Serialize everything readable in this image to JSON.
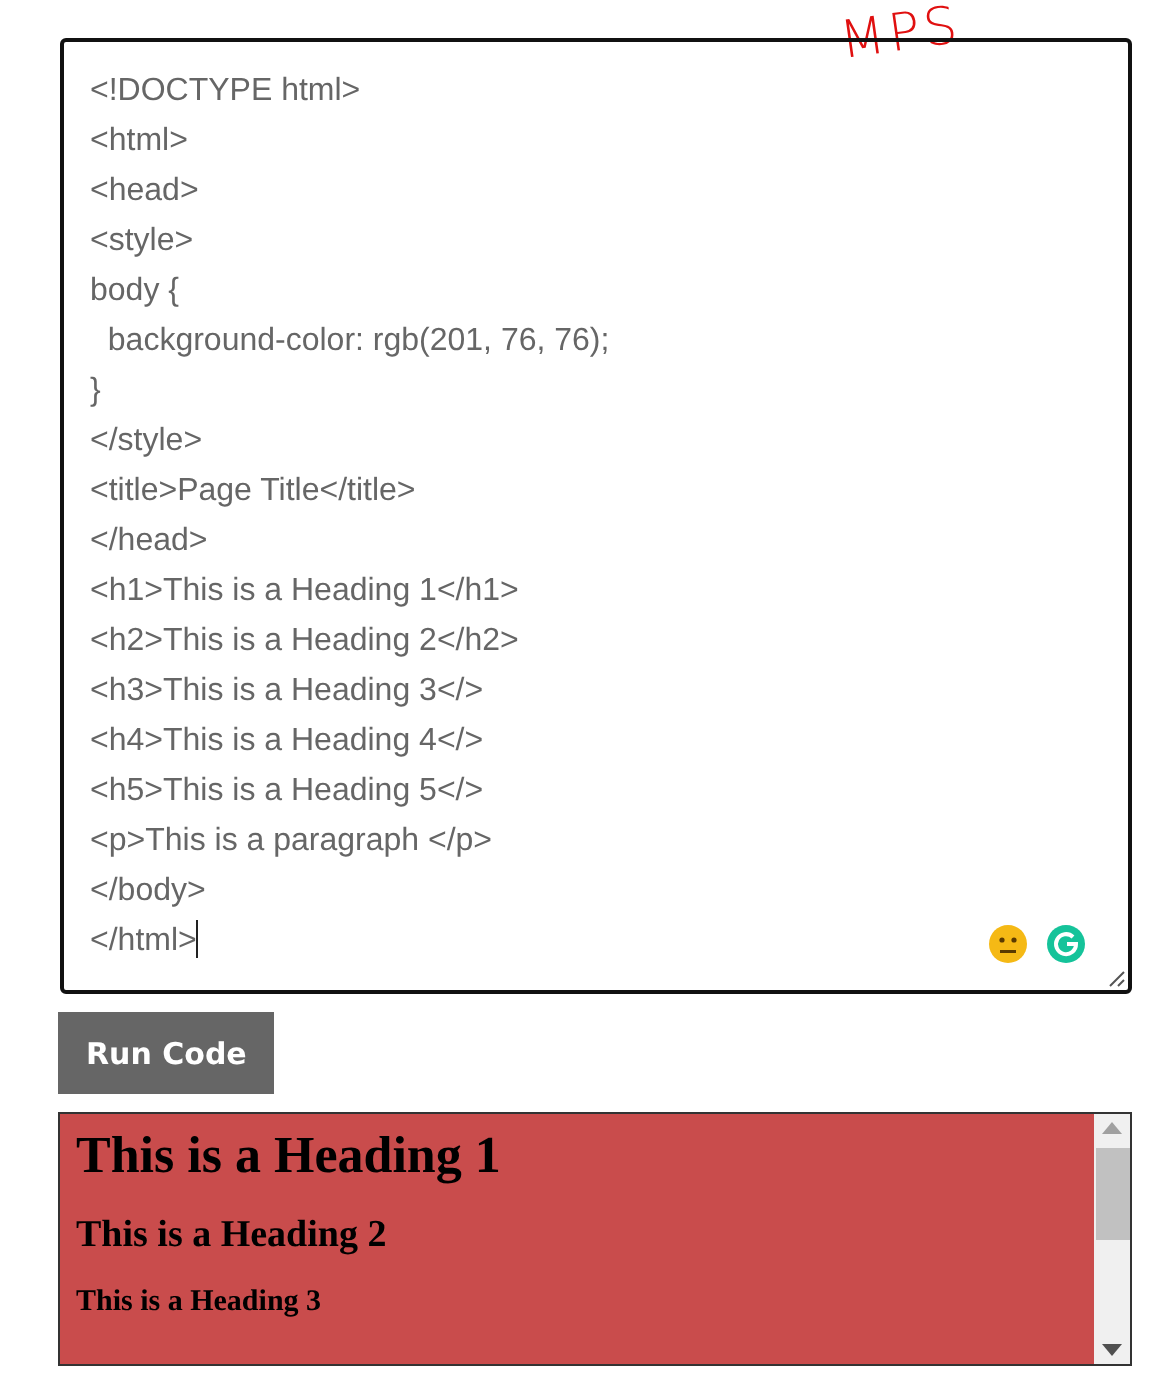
{
  "annotation": "MPS",
  "editor": {
    "lines": [
      "<!DOCTYPE html>",
      "<html>",
      "<head>",
      "<style>",
      "body {",
      "  background-color: rgb(201, 76, 76);",
      "}",
      "</style>",
      "<title>Page Title</title>",
      "</head>",
      "<h1>This is a Heading 1</h1>",
      "<h2>This is a Heading 2</h2>",
      "<h3>This is a Heading 3</>",
      "<h4>This is a Heading 4</>",
      "<h5>This is a Heading 5</>",
      "<p>This is a paragraph </p>",
      "</body>",
      "</html>"
    ]
  },
  "run_button": {
    "label": "Run Code"
  },
  "preview": {
    "headings": [
      {
        "kind": "h1",
        "text": "This is a Heading 1"
      },
      {
        "kind": "h2",
        "text": "This is a Heading 2"
      },
      {
        "kind": "h3",
        "text": "This is a Heading 3"
      }
    ]
  }
}
